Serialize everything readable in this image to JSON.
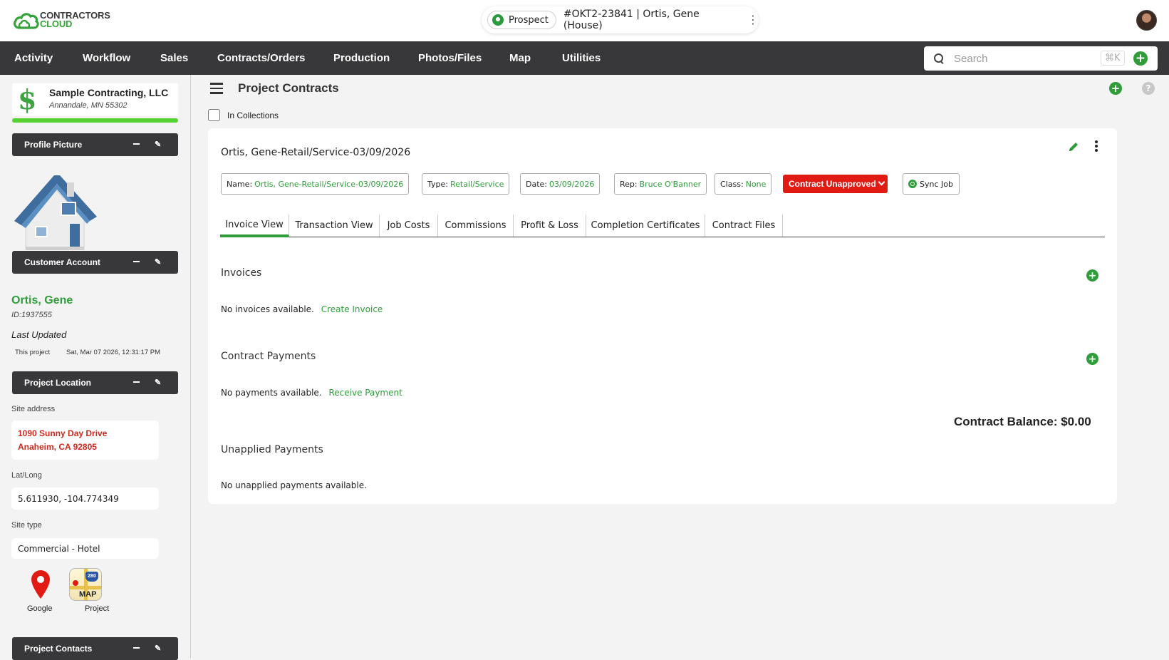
{
  "brand": {
    "line1": "CONTRACTORS",
    "line2": "CLOUD"
  },
  "project_pill": {
    "status": "Prospect",
    "code": "#OKT2-23841 | Ortis, Gene (House)"
  },
  "nav": {
    "items": [
      "Activity",
      "Workflow",
      "Sales",
      "Contracts/Orders",
      "Production",
      "Photos/Files",
      "Map",
      "Utilities"
    ]
  },
  "search": {
    "placeholder": "Search",
    "shortcut": "⌘K"
  },
  "sidebar": {
    "company_name": "Sample Contracting, LLC",
    "company_location": "Annandale, MN 55302",
    "profile_picture_title": "Profile Picture",
    "customer_account_title": "Customer Account",
    "customer_name": "Ortis, Gene",
    "customer_id": "ID:1937555",
    "last_updated_label": "Last Updated",
    "last_updated_scope": "This project",
    "last_updated_date": "Sat, Mar 07 2026, 12:31:17 PM",
    "project_location_title": "Project Location",
    "site_address_label": "Site address",
    "site_address_line1": "1090 Sunny Day Drive",
    "site_address_line2": "Anaheim, CA 92805",
    "latlong_label": "Lat/Long",
    "latlong_value": "5.611930, -104.774349",
    "site_type_label": "Site type",
    "site_type_value": "Commercial - Hotel",
    "map_google_label": "Google",
    "map_project_label": "Project",
    "map_app_text": "MAP",
    "map_app_shield": "280",
    "project_contacts_title": "Project Contacts"
  },
  "main": {
    "title": "Project Contracts",
    "in_collections_label": "In Collections",
    "contract_title": "Ortis, Gene-Retail/Service-03/09/2026",
    "chips": {
      "name_label": "Name:",
      "name_value": "Ortis, Gene-Retail/Service-03/09/2026",
      "type_label": "Type:",
      "type_value": "Retail/Service",
      "date_label": "Date:",
      "date_value": "03/09/2026",
      "rep_label": "Rep:",
      "rep_value": "Bruce O'Banner",
      "class_label": "Class:",
      "class_value": "None"
    },
    "status": "Contract Unapproved",
    "sync_label": "Sync Job",
    "tabs": [
      "Invoice View",
      "Transaction View",
      "Job Costs",
      "Commissions",
      "Profit & Loss",
      "Completion Certificates",
      "Contract Files"
    ],
    "invoices_title": "Invoices",
    "invoices_empty": "No invoices available.",
    "create_invoice": "Create Invoice",
    "payments_title": "Contract Payments",
    "payments_empty": "No payments available.",
    "receive_payment": "Receive Payment",
    "balance": "Contract Balance: $0.00",
    "unapplied_title": "Unapplied Payments",
    "unapplied_empty": "No unapplied payments available."
  },
  "colors": {
    "accent": "#2e9d3a",
    "nav_bg": "#38383a",
    "status_red": "#e11a14",
    "progress": "#54d330"
  }
}
